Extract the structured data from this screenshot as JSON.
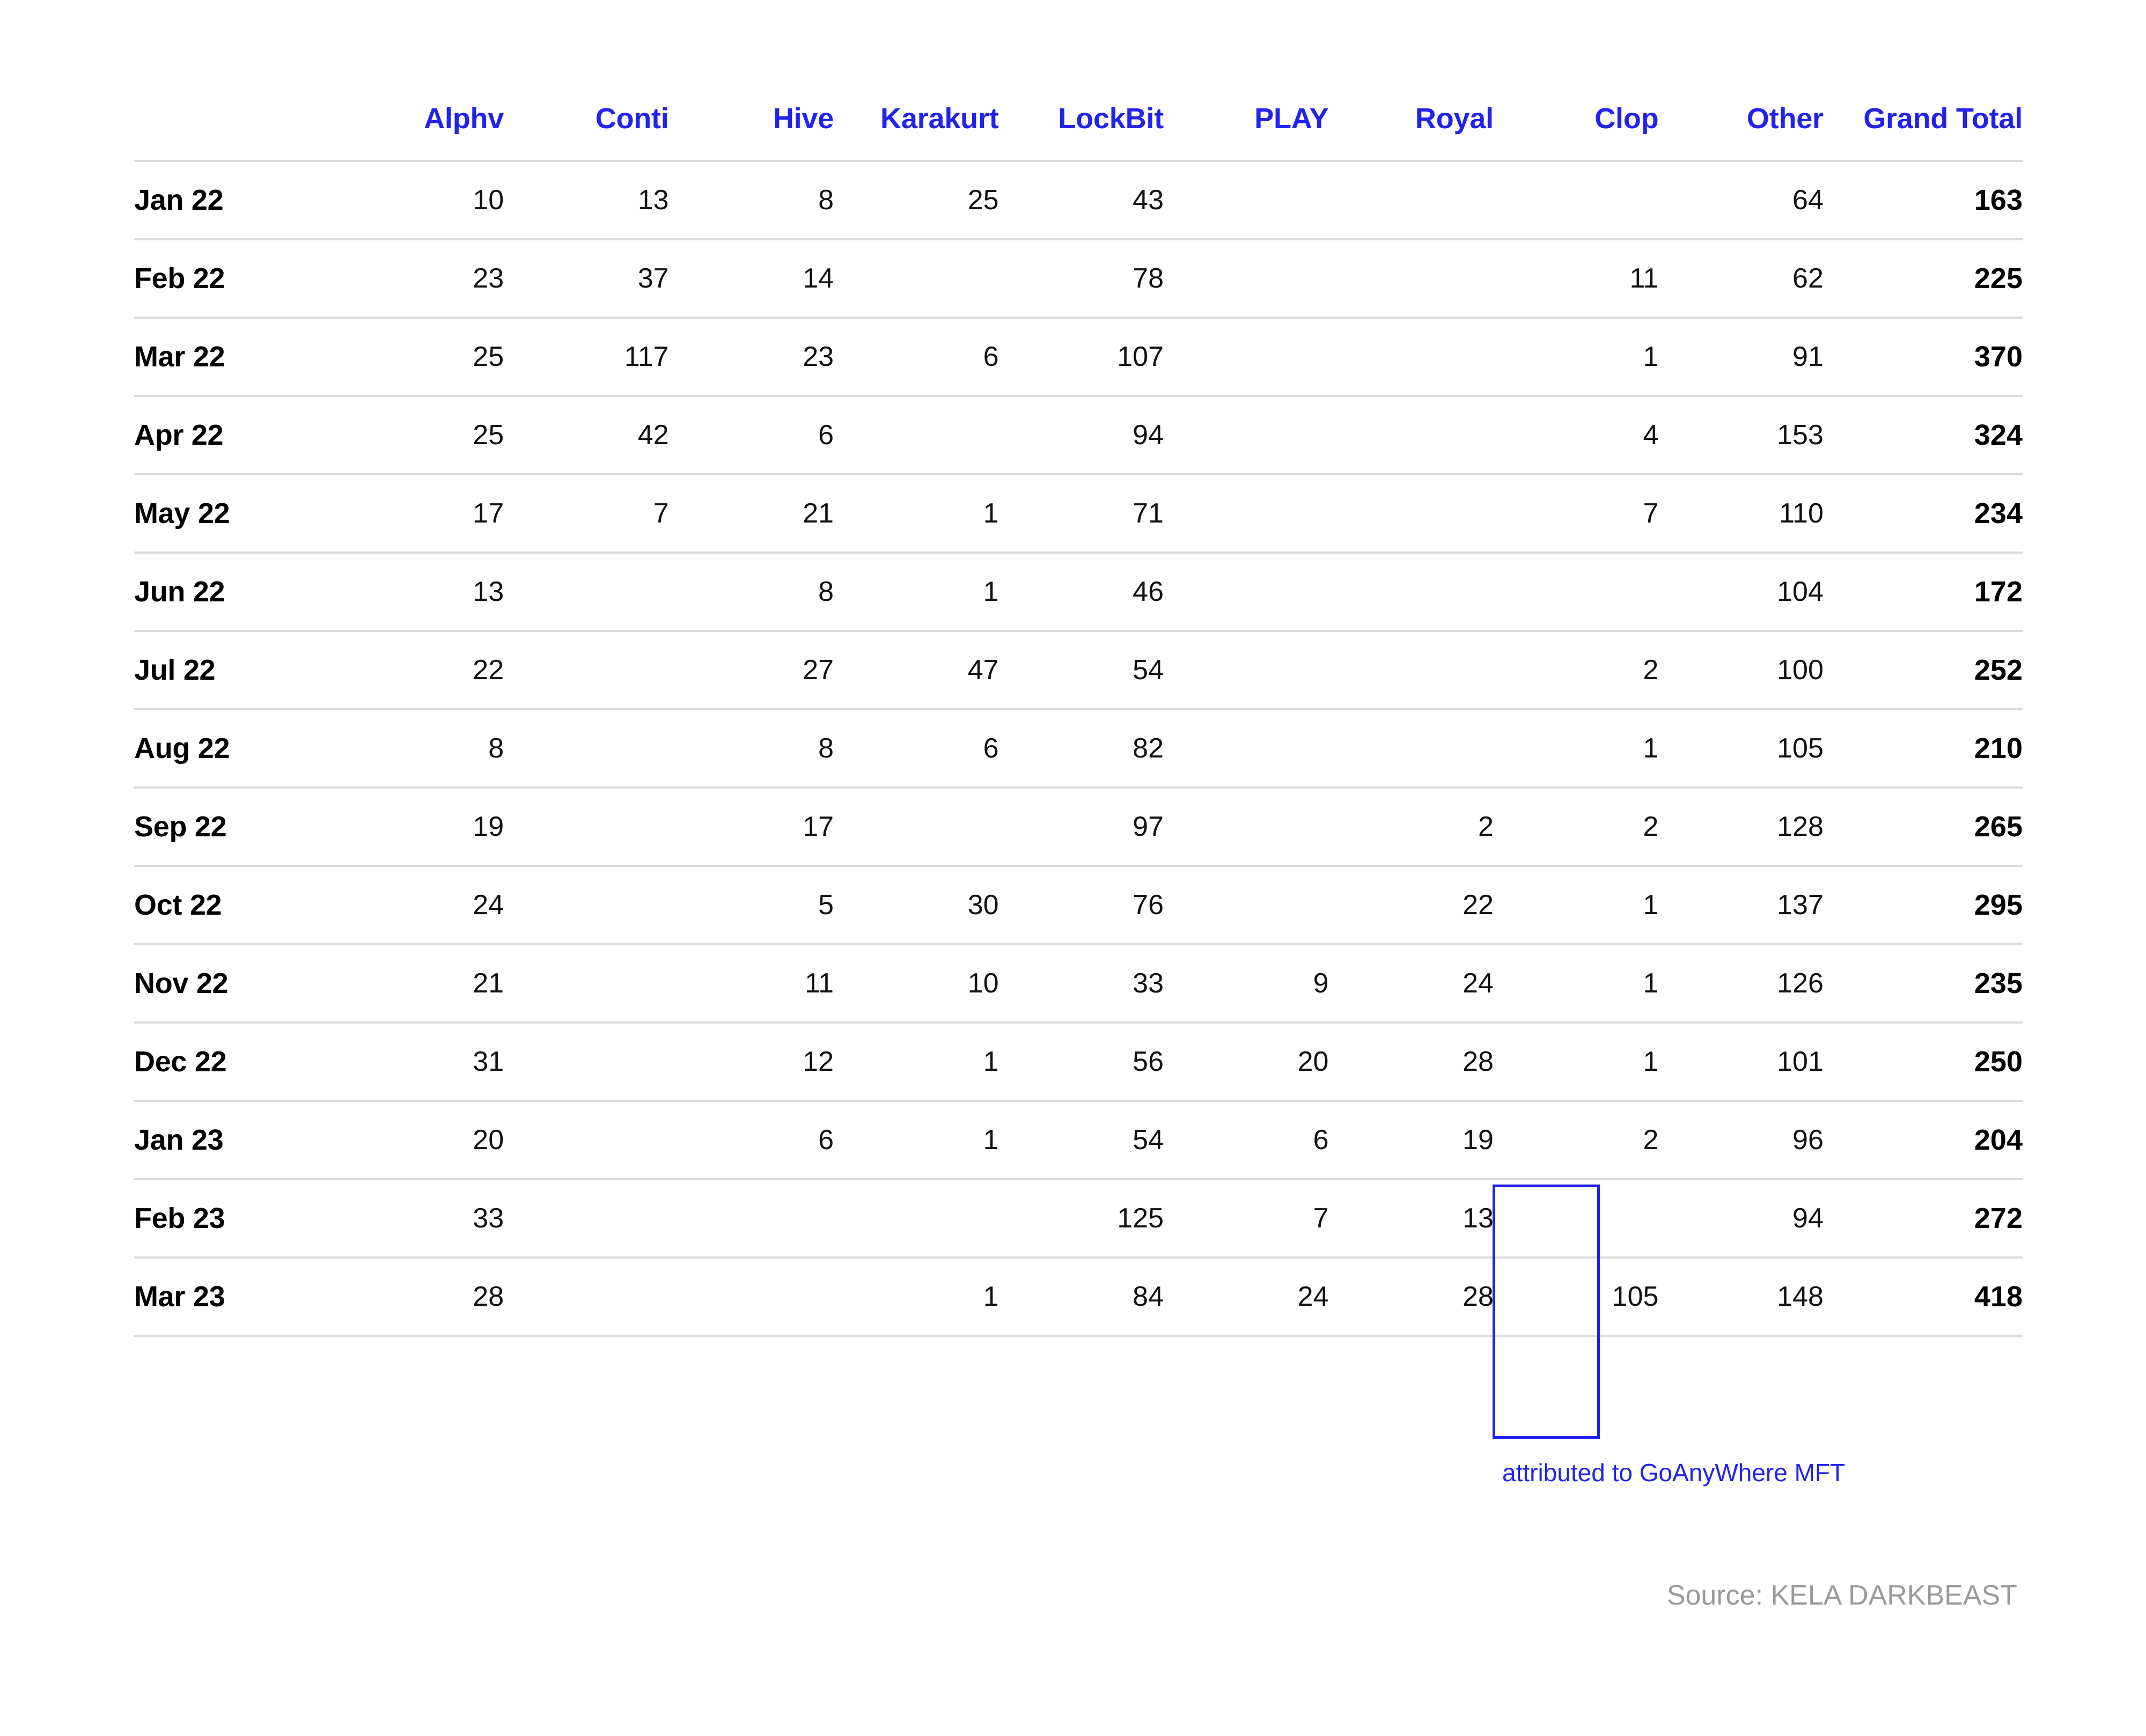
{
  "chart_data": {
    "type": "table",
    "title": "",
    "columns": [
      "",
      "Alphv",
      "Conti",
      "Hive",
      "Karakurt",
      "LockBit",
      "PLAY",
      "Royal",
      "Clop",
      "Other",
      "Grand Total"
    ],
    "row_header_label": "",
    "categories": [
      "Jan 22",
      "Feb 22",
      "Mar 22",
      "Apr 22",
      "May 22",
      "Jun 22",
      "Jul 22",
      "Aug 22",
      "Sep 22",
      "Oct 22",
      "Nov 22",
      "Dec 22",
      "Jan 23",
      "Feb 23",
      "Mar 23"
    ],
    "series": [
      {
        "name": "Alphv",
        "values": [
          10,
          23,
          25,
          25,
          17,
          13,
          22,
          8,
          19,
          24,
          21,
          31,
          20,
          33,
          28
        ]
      },
      {
        "name": "Conti",
        "values": [
          13,
          37,
          117,
          42,
          7,
          null,
          null,
          null,
          null,
          null,
          null,
          null,
          null,
          null,
          null
        ]
      },
      {
        "name": "Hive",
        "values": [
          8,
          14,
          23,
          6,
          21,
          8,
          27,
          8,
          17,
          5,
          11,
          12,
          6,
          null,
          null
        ]
      },
      {
        "name": "Karakurt",
        "values": [
          25,
          null,
          6,
          null,
          1,
          1,
          47,
          6,
          null,
          30,
          10,
          1,
          1,
          null,
          1
        ]
      },
      {
        "name": "LockBit",
        "values": [
          43,
          78,
          107,
          94,
          71,
          46,
          54,
          82,
          97,
          76,
          33,
          56,
          54,
          125,
          84
        ]
      },
      {
        "name": "PLAY",
        "values": [
          null,
          null,
          null,
          null,
          null,
          null,
          null,
          null,
          null,
          null,
          9,
          20,
          6,
          7,
          24
        ]
      },
      {
        "name": "Royal",
        "values": [
          null,
          null,
          null,
          null,
          null,
          null,
          null,
          null,
          2,
          22,
          24,
          28,
          19,
          13,
          28
        ]
      },
      {
        "name": "Clop",
        "values": [
          null,
          11,
          1,
          4,
          7,
          null,
          2,
          1,
          2,
          1,
          1,
          1,
          2,
          null,
          105
        ]
      },
      {
        "name": "Other",
        "values": [
          64,
          62,
          91,
          153,
          110,
          104,
          100,
          105,
          128,
          137,
          126,
          101,
          96,
          94,
          148
        ]
      },
      {
        "name": "Grand Total",
        "values": [
          163,
          225,
          370,
          324,
          234,
          172,
          252,
          210,
          265,
          295,
          235,
          250,
          204,
          272,
          418
        ]
      }
    ],
    "rows": [
      {
        "label": "Jan 22",
        "cells": [
          "10",
          "13",
          "8",
          "25",
          "43",
          "",
          "",
          "",
          "64",
          "163"
        ]
      },
      {
        "label": "Feb 22",
        "cells": [
          "23",
          "37",
          "14",
          "",
          "78",
          "",
          "",
          "11",
          "62",
          "225"
        ]
      },
      {
        "label": "Mar 22",
        "cells": [
          "25",
          "117",
          "23",
          "6",
          "107",
          "",
          "",
          "1",
          "91",
          "370"
        ]
      },
      {
        "label": "Apr 22",
        "cells": [
          "25",
          "42",
          "6",
          "",
          "94",
          "",
          "",
          "4",
          "153",
          "324"
        ]
      },
      {
        "label": "May 22",
        "cells": [
          "17",
          "7",
          "21",
          "1",
          "71",
          "",
          "",
          "7",
          "110",
          "234"
        ]
      },
      {
        "label": "Jun 22",
        "cells": [
          "13",
          "",
          "8",
          "1",
          "46",
          "",
          "",
          "",
          "104",
          "172"
        ]
      },
      {
        "label": "Jul 22",
        "cells": [
          "22",
          "",
          "27",
          "47",
          "54",
          "",
          "",
          "2",
          "100",
          "252"
        ]
      },
      {
        "label": "Aug 22",
        "cells": [
          "8",
          "",
          "8",
          "6",
          "82",
          "",
          "",
          "1",
          "105",
          "210"
        ]
      },
      {
        "label": "Sep 22",
        "cells": [
          "19",
          "",
          "17",
          "",
          "97",
          "",
          "2",
          "2",
          "128",
          "265"
        ]
      },
      {
        "label": "Oct 22",
        "cells": [
          "24",
          "",
          "5",
          "30",
          "76",
          "",
          "22",
          "1",
          "137",
          "295"
        ]
      },
      {
        "label": "Nov 22",
        "cells": [
          "21",
          "",
          "11",
          "10",
          "33",
          "9",
          "24",
          "1",
          "126",
          "235"
        ]
      },
      {
        "label": "Dec 22",
        "cells": [
          "31",
          "",
          "12",
          "1",
          "56",
          "20",
          "28",
          "1",
          "101",
          "250"
        ]
      },
      {
        "label": "Jan 23",
        "cells": [
          "20",
          "",
          "6",
          "1",
          "54",
          "6",
          "19",
          "2",
          "96",
          "204"
        ]
      },
      {
        "label": "Feb 23",
        "cells": [
          "33",
          "",
          "",
          "",
          "125",
          "7",
          "13",
          "",
          "94",
          "272"
        ]
      },
      {
        "label": "Mar 23",
        "cells": [
          "28",
          "",
          "",
          "1",
          "84",
          "24",
          "28",
          "105",
          "148",
          "418"
        ]
      }
    ],
    "annotations": [
      {
        "text": "attributed to GoAnyWhere MFT",
        "color": "#2222ee",
        "target_column": "Clop",
        "target_rows": [
          "Jan 23",
          "Feb 23",
          "Mar 23"
        ]
      }
    ],
    "highlight": {
      "column": "Clop",
      "rows": [
        "Jan 23",
        "Feb 23",
        "Mar 23"
      ],
      "color": "#2222ee"
    },
    "source": "Source: KELA DARKBEAST",
    "colors": {
      "header": "#2222ee",
      "body_text": "#111111",
      "grid": "#dcdcdc",
      "source_text": "#9a9a9a",
      "highlight": "#2222ee"
    }
  },
  "table": {
    "headers": [
      "",
      "Alphv",
      "Conti",
      "Hive",
      "Karakurt",
      "LockBit",
      "PLAY",
      "Royal",
      "Clop",
      "Other",
      "Grand Total"
    ]
  },
  "annotation": {
    "text": "attributed to GoAnyWhere MFT"
  },
  "source": {
    "text": "Source: KELA DARKBEAST"
  }
}
